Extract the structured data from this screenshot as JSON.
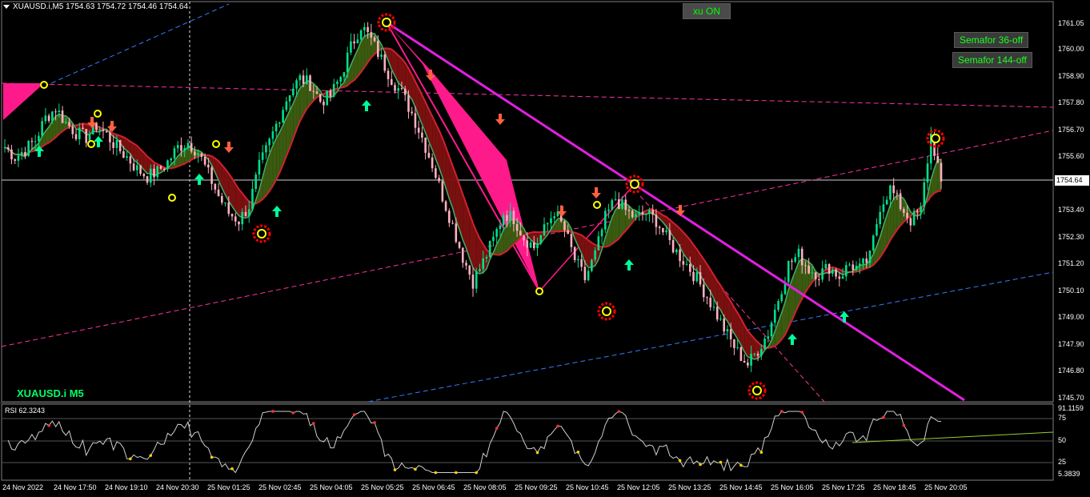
{
  "chart_title": "XUAUSD.i,M5  1754.63 1754.72 1754.46 1754.64",
  "symbol_label": "XUAUSD.i M5",
  "buttons": {
    "xu": "xu ON",
    "semafor36": "Semafor 36-off",
    "semafor144": "Semafor 144-off"
  },
  "current_price": "1754.64",
  "price_labels": [
    "1761.05",
    "1760.00",
    "1758.90",
    "1757.80",
    "1756.70",
    "1755.60",
    "1753.40",
    "1752.30",
    "1751.20",
    "1750.10",
    "1749.00",
    "1747.90",
    "1746.80",
    "1745.70"
  ],
  "time_labels": [
    "24 Nov 2022",
    "24 Nov 17:50",
    "24 Nov 19:10",
    "24 Nov 20:30",
    "25 Nov 01:25",
    "25 Nov 02:45",
    "25 Nov 04:05",
    "25 Nov 05:25",
    "25 Nov 06:45",
    "25 Nov 08:05",
    "25 Nov 09:25",
    "25 Nov 10:45",
    "25 Nov 12:05",
    "25 Nov 13:25",
    "25 Nov 14:45",
    "25 Nov 16:05",
    "25 Nov 17:25",
    "25 Nov 18:45",
    "25 Nov 20:05"
  ],
  "rsi": {
    "label": "RSI 62.3243",
    "levels": [
      "91.1159",
      "75",
      "50",
      "25",
      "5.3839"
    ]
  },
  "colors": {
    "bull_candle": "#00e08a",
    "bear_candle": "#ffb0c0",
    "up_band": "#3a5a10",
    "down_band": "#7a1010",
    "trendline": "#e020e0",
    "zigzag": "#ff1a8c",
    "arrow_up": "#00ff9c",
    "arrow_down": "#ff6040"
  },
  "chart_data": {
    "type": "candlestick",
    "symbol": "XUAUSD.i",
    "timeframe": "M5",
    "ohlc_current": {
      "open": 1754.63,
      "high": 1754.72,
      "low": 1754.46,
      "close": 1754.64
    },
    "ylim": [
      1745.3,
      1761.6
    ],
    "close_series": [
      1756.0,
      1755.6,
      1755.9,
      1756.3,
      1757.2,
      1757.6,
      1757.0,
      1756.6,
      1756.4,
      1756.9,
      1756.5,
      1756.0,
      1755.6,
      1755.1,
      1754.8,
      1755.0,
      1755.4,
      1756.0,
      1756.2,
      1755.8,
      1754.9,
      1754.0,
      1753.3,
      1753.0,
      1753.6,
      1755.2,
      1756.2,
      1757.3,
      1758.3,
      1758.8,
      1758.6,
      1757.9,
      1758.1,
      1758.9,
      1760.1,
      1761.0,
      1760.4,
      1759.6,
      1758.8,
      1758.2,
      1757.4,
      1756.4,
      1755.3,
      1754.0,
      1752.8,
      1751.5,
      1750.5,
      1751.3,
      1752.2,
      1753.3,
      1753.1,
      1752.3,
      1751.9,
      1752.6,
      1753.4,
      1752.6,
      1751.4,
      1750.6,
      1751.6,
      1753.1,
      1753.9,
      1753.4,
      1753.1,
      1753.3,
      1753.0,
      1752.3,
      1751.7,
      1751.2,
      1750.6,
      1749.9,
      1749.1,
      1748.3,
      1747.6,
      1747.1,
      1747.7,
      1748.4,
      1749.8,
      1751.2,
      1751.6,
      1751.0,
      1750.8,
      1751.1,
      1750.7,
      1751.2,
      1751.0,
      1751.5,
      1753.6,
      1754.3,
      1753.6,
      1753.0,
      1753.4,
      1756.5,
      1754.6
    ],
    "trendline_high": {
      "from": 1761.0,
      "to": 1745.6
    },
    "zigzag_points": [
      1758.6,
      1761.0,
      1750.1,
      1754.6
    ],
    "rsi_value": 62.3243
  }
}
